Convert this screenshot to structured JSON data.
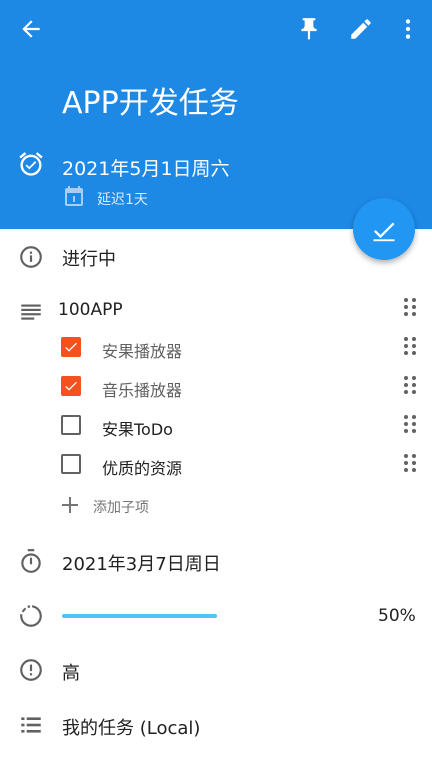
{
  "task": {
    "title": "APP开发任务",
    "due_date": "2021年5月1日周六",
    "delay": "延迟1天",
    "status": "进行中"
  },
  "checklist": {
    "title": "100APP",
    "items": [
      {
        "label": "安果播放器",
        "checked": true
      },
      {
        "label": "音乐播放器",
        "checked": true
      },
      {
        "label": "安果ToDo",
        "checked": false
      },
      {
        "label": "优质的资源",
        "checked": false
      }
    ],
    "add_label": "添加子项"
  },
  "start_date": "2021年3月7日周日",
  "progress": {
    "percent": 50,
    "label": "50%"
  },
  "priority": "高",
  "list_name": "我的任务 (Local)",
  "colors": {
    "header": "#1e88e5",
    "fab": "#2196f3",
    "check": "#f4511e",
    "progress": "#4fc3f7"
  },
  "icons": [
    "back-arrow-icon",
    "pin-icon",
    "edit-pencil-icon",
    "more-vert-icon",
    "alarm-icon",
    "calendar-icon",
    "check-icon",
    "info-icon",
    "notes-icon",
    "timer-icon",
    "progress-icon",
    "priority-icon",
    "list-icon",
    "drag-handle-icon",
    "plus-icon"
  ]
}
